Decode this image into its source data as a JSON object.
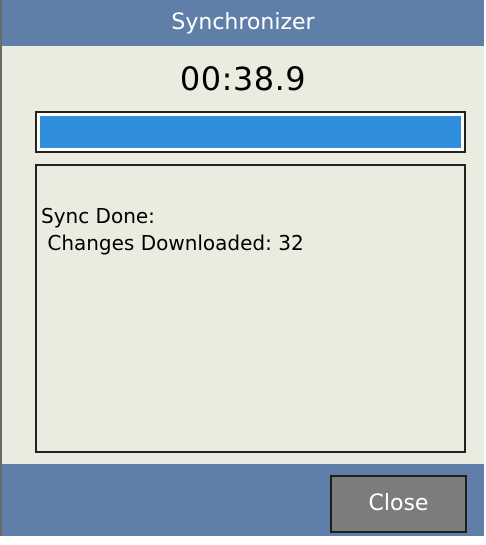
{
  "window": {
    "title": "Synchronizer"
  },
  "timer": {
    "elapsed": "00:38.9"
  },
  "progress": {
    "value": 1.0,
    "color": "#2f8fdd"
  },
  "log": {
    "lines": [
      "Sync Done:",
      " Changes Downloaded: 32"
    ]
  },
  "actions": {
    "close_label": "Close"
  },
  "colors": {
    "title_bar": "#5f7fa8",
    "window_bg": "#ebebdf",
    "button_bg": "#7c7c7c"
  }
}
